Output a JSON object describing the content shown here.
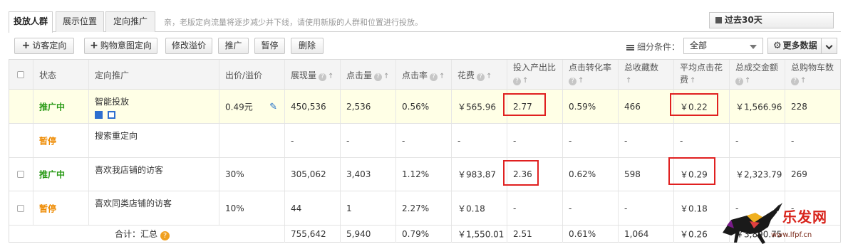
{
  "tabs": [
    {
      "label": "投放人群",
      "active": true
    },
    {
      "label": "展示位置",
      "active": false
    },
    {
      "label": "定向推广",
      "active": false
    }
  ],
  "notice": "亲，老版定向流量将逐步减少并下线，请使用新版的人群和位置进行投放。",
  "date_range": "过去30天",
  "toolbar": {
    "add_visitor_targeting": "访客定向",
    "add_intent_targeting": "购物意图定向",
    "modify_premium": "修改溢价",
    "promote": "推广",
    "pause": "暂停",
    "delete": "删除"
  },
  "filter": {
    "label": "细分条件：",
    "value": "全部"
  },
  "more_data": "更多数据",
  "columns": [
    "状态",
    "定向推广",
    "出价/溢价",
    "展现量",
    "点击量",
    "点击率",
    "花费",
    "投入产出比",
    "点击转化率",
    "总收藏数",
    "平均点击花费",
    "总成交金额",
    "总购物车数"
  ],
  "rows": [
    {
      "status": "推广中",
      "status_kind": "on",
      "name": "智能投放",
      "bid": "0.49元",
      "impressions": "450,536",
      "clicks": "2,536",
      "ctr": "0.56%",
      "cost": "￥565.96",
      "roi": "2.77",
      "cvr": "0.59%",
      "favorites": "466",
      "cpc": "￥0.22",
      "gmv": "￥1,566.96",
      "carts": "228"
    },
    {
      "status": "暂停",
      "status_kind": "pause",
      "name": "搜索重定向",
      "bid": "",
      "impressions": "-",
      "clicks": "-",
      "ctr": "-",
      "cost": "-",
      "roi": "-",
      "cvr": "-",
      "favorites": "-",
      "cpc": "-",
      "gmv": "-",
      "carts": "-"
    },
    {
      "status": "推广中",
      "status_kind": "on",
      "name": "喜欢我店铺的访客",
      "bid": "30%",
      "impressions": "305,062",
      "clicks": "3,403",
      "ctr": "1.12%",
      "cost": "￥983.87",
      "roi": "2.36",
      "cvr": "0.62%",
      "favorites": "598",
      "cpc": "￥0.29",
      "gmv": "￥2,323.79",
      "carts": "269"
    },
    {
      "status": "暂停",
      "status_kind": "pause",
      "name": "喜欢同类店铺的访客",
      "bid": "10%",
      "impressions": "44",
      "clicks": "1",
      "ctr": "2.27%",
      "cost": "￥0.18",
      "roi": "-",
      "cvr": "-",
      "favorites": "-",
      "cpc": "￥0.18",
      "gmv": "-",
      "carts": "-"
    }
  ],
  "total": {
    "label": "合计：汇总",
    "impressions": "755,642",
    "clicks": "5,940",
    "ctr": "0.79%",
    "cost": "￥1,550.01",
    "roi": "2.51",
    "cvr": "0.61%",
    "favorites": "1,064",
    "cpc": "￥0.26",
    "gmv": "￥3,890.75",
    "carts": ""
  },
  "watermark": {
    "text": "乐发网",
    "url": "www.lfpf.cn"
  },
  "colors": {
    "status_on": "#2a9a16",
    "status_pause": "#ee8a00",
    "highlight_row": "#ffffe6",
    "annotation_box": "#e02020",
    "edit_icon": "#1e6ec8"
  }
}
